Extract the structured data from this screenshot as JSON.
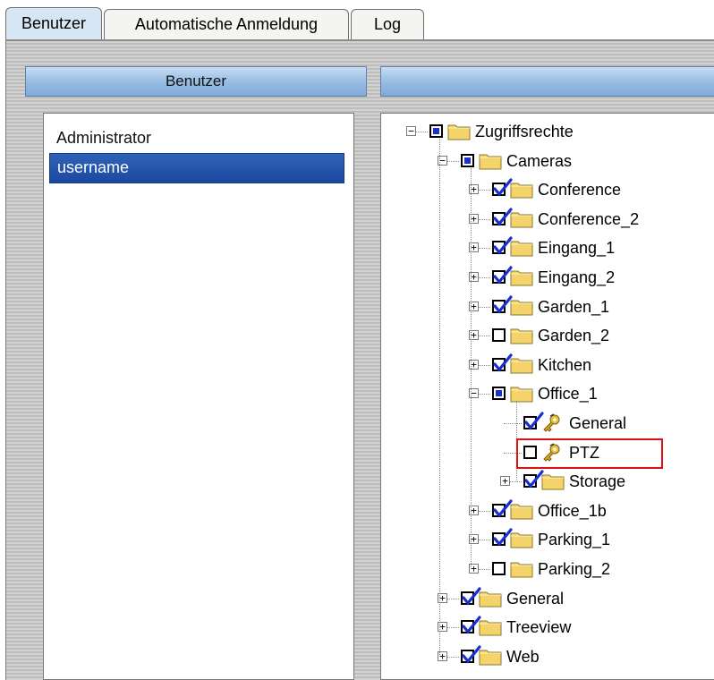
{
  "tabs": [
    "Benutzer",
    "Automatische Anmeldung",
    "Log"
  ],
  "users_panel": {
    "header": "Benutzer",
    "users": [
      "Administrator",
      "username"
    ],
    "selected": "username"
  },
  "rights_panel": {
    "header": "",
    "tree": {
      "root": "Zugriffsrechte",
      "cameras": "Cameras",
      "camera_items": [
        "Conference",
        "Conference_2",
        "Eingang_1",
        "Eingang_2",
        "Garden_1",
        "Garden_2",
        "Kitchen",
        "Office_1"
      ],
      "office_children": [
        "General",
        "PTZ",
        "Storage"
      ],
      "camera_items_after": [
        "Office_1b",
        "Parking_1",
        "Parking_2"
      ],
      "root_items": [
        "General",
        "Treeview",
        "Web"
      ]
    }
  },
  "colors": {
    "selection": "#1b48a0",
    "header": "#9cc0e6",
    "check": "#1a2fd0",
    "highlight": "#e01010"
  }
}
